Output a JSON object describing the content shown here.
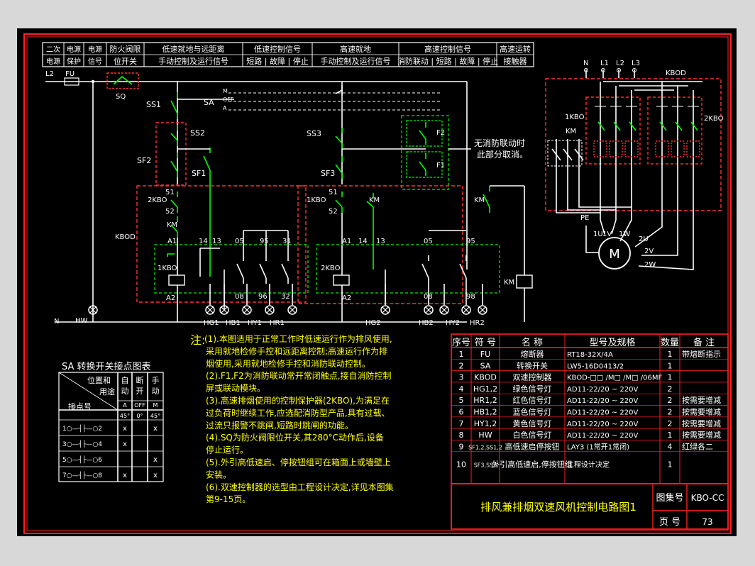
{
  "header_cells": [
    {
      "id": "h1",
      "lines": [
        "二次",
        "电源"
      ]
    },
    {
      "id": "h2",
      "lines": [
        "电源",
        "保护"
      ]
    },
    {
      "id": "h3",
      "lines": [
        "电源",
        "信号"
      ]
    },
    {
      "id": "h4",
      "lines": [
        "防火阀限",
        "位开关"
      ]
    },
    {
      "id": "h5",
      "lines": [
        "低速就地与远距离",
        "手动控制及运行信号"
      ]
    },
    {
      "id": "h6",
      "lines": [
        "低速控制信号",
        "短路 | 故障 | 停止"
      ]
    },
    {
      "id": "h7",
      "lines": [
        "高速就地",
        "手动控制及运行信号"
      ]
    },
    {
      "id": "h8",
      "lines": [
        "高速控制信号",
        "消防联动 | 短路 | 故障 | 停止"
      ]
    },
    {
      "id": "h9",
      "lines": [
        "高速运转",
        "接触器"
      ]
    }
  ],
  "labels": {
    "l2": "L2",
    "fu": "FU",
    "sq": "SQ",
    "ss1": "SS1",
    "sa": "SA",
    "ss2": "SS2",
    "sf2": "SF2",
    "sf1": "SF1",
    "kbo_1": "2KBO",
    "km_1": "KM",
    "kbod": "KBOD",
    "a1_1": "A1",
    "n14_1": "14",
    "n13_1": "13",
    "n05_1": "05",
    "n95_1": "95",
    "n31": "31",
    "kbo1": "1KBO",
    "a2_1": "A2",
    "n08_1": "08",
    "n96_1": "96",
    "n32": "32",
    "ss3": "SS3",
    "sf3": "SF3",
    "kbo1b": "1KBO",
    "km_2": "KM",
    "a1_2": "A1",
    "n14_2": "14",
    "n13_2": "13",
    "n05_2": "05",
    "n95_2": "95",
    "kbo2": "2KBO",
    "a2_2": "A2",
    "n08_2": "08",
    "n98": "98",
    "km_3": "KM",
    "km_coil": "KM",
    "f1": "F1",
    "f2": "F2",
    "note_fire": "无消防联动时",
    "note_fire2": "此部分取消。",
    "m_on": "M",
    "m_off": "OFF",
    "m_a": "A",
    "n51_1": "51",
    "n52_1": "52",
    "n51_2": "51",
    "n52_2": "52",
    "n_bus": "N",
    "hw": "HW",
    "hg1": "HG1",
    "hb1": "HB1",
    "hy1": "HY1",
    "hr1": "HR1",
    "hg2": "HG2",
    "hb2": "HB2",
    "hy2": "HY2",
    "hr2": "HR2",
    "p_n": "N",
    "p_l1": "L1",
    "p_l2": "L2",
    "p_l3": "L3",
    "p_kbod": "KBOD",
    "p_1kbo": "1KBO",
    "p_2kbo": "2KBO",
    "p_km": "KM",
    "pe": "PE",
    "u1": "1U",
    "v1": "1V",
    "w1": "1W",
    "u2": "2U",
    "v2": "2V",
    "w2": "2W",
    "motor": "M"
  },
  "sa_table": {
    "title": "SA 转换开关接点图表",
    "corner_top": "位置和",
    "corner_mid": "用途",
    "corner_bottom": "接点号",
    "col_heads": [
      [
        "自",
        "动"
      ],
      [
        "断",
        "开"
      ],
      [
        "手",
        "动"
      ]
    ],
    "col_pos": [
      "A",
      "OFF",
      "M"
    ],
    "col_deg": [
      "45°",
      "0°",
      "45°"
    ],
    "rows": [
      {
        "contact": "1○—┤├—○2",
        "marks": [
          "x",
          "",
          "x"
        ]
      },
      {
        "contact": "3○—┤├—○4",
        "marks": [
          "x",
          "",
          ""
        ]
      },
      {
        "contact": "5○—┤├—○6",
        "marks": [
          "",
          "",
          "x"
        ]
      },
      {
        "contact": "7○—┤├—○8",
        "marks": [
          "x",
          "",
          "x"
        ]
      }
    ]
  },
  "notes": {
    "head": "注:",
    "lines": [
      "(1).本图适用于正常工作时低速运行作为排风使用,",
      "采用就地检修手控和远距离控制;高速运行作为排",
      "烟使用,采用就地检修手控和消防联动控制。",
      "(2).F1,F2为消防联动常开常闭触点,接自消防控制",
      "屏或联动模块。",
      "(3).高速排烟使用的控制保护器(2KBO),为满足在",
      "过负荷时继续工作,应选配消防型产品,具有过载、",
      "过流只报警不跳闸,短路时跳闸的功能。",
      "(4).SQ为防火阀限位开关,其280°C动作后,设备",
      "停止运行。",
      "(5).外引高低速启、停按钮组可在箱面上或墙壁上",
      "安装。",
      "(6).双速控制器的选型由工程设计决定,详见本图集",
      "第9-15页。"
    ]
  },
  "parts_table": {
    "headers": [
      "序号",
      "符 号",
      "名 称",
      "型号及规格",
      "数量",
      "备 注"
    ],
    "rows": [
      [
        "1",
        "FU",
        "熔断器",
        "RT18-32X/4A",
        "1",
        "带熔断指示"
      ],
      [
        "2",
        "SA",
        "转换开关",
        "LW5-16D0413/2",
        "1",
        ""
      ],
      [
        "3",
        "KBOD",
        "双速控制器",
        "KBOD-□□ /M□ /M□ /06MF",
        "1",
        ""
      ],
      [
        "4",
        "HG1,2",
        "绿色信号灯",
        "AD11-22/20 ~ 220V",
        "2",
        ""
      ],
      [
        "5",
        "HR1,2",
        "红色信号灯",
        "AD11-22/20 ~ 220V",
        "2",
        "按需要增减"
      ],
      [
        "6",
        "HB1,2",
        "蓝色信号灯",
        "AD11-22/20 ~ 220V",
        "2",
        "按需要增减"
      ],
      [
        "7",
        "HY1,2",
        "黄色信号灯",
        "AD11-22/20 ~ 220V",
        "2",
        "按需要增减"
      ],
      [
        "8",
        "HW",
        "白色信号灯",
        "AD11-22/20 ~ 220V",
        "1",
        "按需要增减"
      ],
      [
        "9",
        "SF1,2,SS1,2",
        "高低速启停按钮",
        "LAY3 (1常开1常闭)",
        "4",
        "红绿各二"
      ],
      [
        "10",
        "SF3,SS3",
        "外引高低速启,停按钮组",
        "工程设计决定",
        "1",
        ""
      ]
    ]
  },
  "title_block": {
    "title": "排风兼排烟双速风机控制电路图1",
    "atlas_label": "图集号",
    "atlas_no": "KBO-CC",
    "page_label": "页 号",
    "page_no": "73"
  },
  "colors": {
    "bg": "#000000",
    "frame": "#ff2020",
    "wire": "#ffffff",
    "contact": "#00ff00",
    "text": "#ffffff",
    "dashed": "#ff3030",
    "green_dash": "#00cc00",
    "yellow": "#ffff00",
    "cyan": "#00ffff"
  }
}
